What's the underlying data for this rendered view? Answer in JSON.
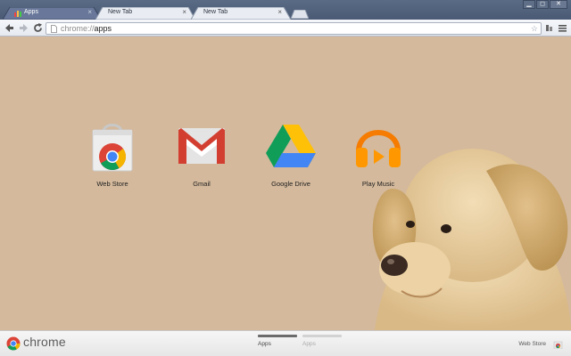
{
  "tabs": [
    {
      "title": "Apps",
      "active": true
    },
    {
      "title": "New Tab",
      "active": false
    },
    {
      "title": "New Tab",
      "active": false
    }
  ],
  "tab_close_glyph": "×",
  "window_controls": {
    "minimize": "▁",
    "maximize": "◻",
    "close": "✕"
  },
  "omnibox": {
    "scheme": "chrome://",
    "host": "apps"
  },
  "apps": [
    {
      "label": "Web Store",
      "icon": "web-store-icon"
    },
    {
      "label": "Gmail",
      "icon": "gmail-icon"
    },
    {
      "label": "Google Drive",
      "icon": "google-drive-icon"
    },
    {
      "label": "Play Music",
      "icon": "play-music-icon"
    }
  ],
  "footer": {
    "brand": "chrome",
    "pages": [
      {
        "label": "Apps",
        "active": true
      },
      {
        "label": "Apps",
        "active": false
      }
    ],
    "webstore_label": "Web Store"
  },
  "theme": {
    "background": "#d4b99c",
    "accent": "#4a5a74"
  }
}
